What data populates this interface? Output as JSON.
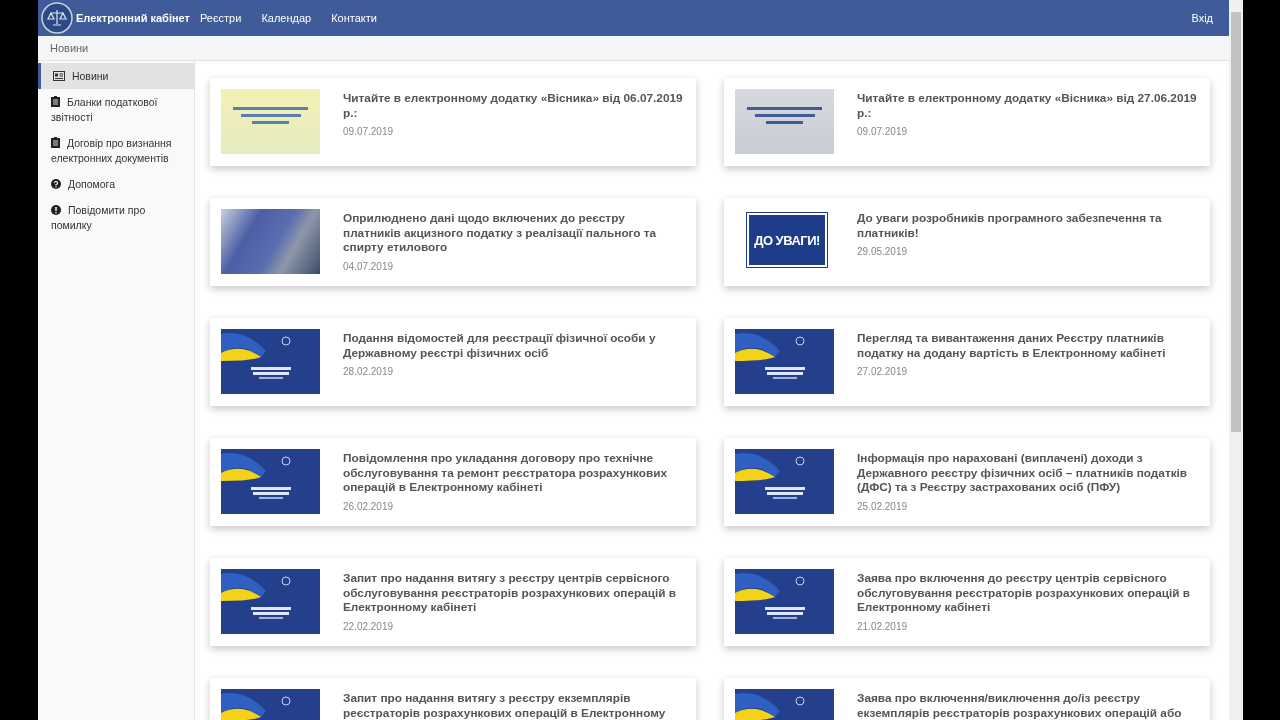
{
  "navbar": {
    "brand": "Електронний кабінет",
    "links": [
      "Реєстри",
      "Календар",
      "Контакти"
    ],
    "login": "Вхід"
  },
  "breadcrumb": "Новини",
  "sidebar": {
    "items": [
      {
        "label": "Новини",
        "selected": true
      },
      {
        "label": "Бланки податкової звітності",
        "selected": false
      },
      {
        "label": "Договір про визнання електронних документів",
        "selected": false
      },
      {
        "label": "Допомога",
        "selected": false
      },
      {
        "label": "Повідомити про помилку",
        "selected": false
      }
    ]
  },
  "news": [
    {
      "title": "Читайте в електронному додатку «Вісника» від 06.07.2019 р.:",
      "date": "09.07.2019",
      "thumb": {
        "kind": "yellow-banner"
      }
    },
    {
      "title": "Читайте в електронному додатку «Вісника» від 27.06.2019 р.:",
      "date": "09.07.2019",
      "thumb": {
        "kind": "grey-banner"
      }
    },
    {
      "title": "Оприлюднено дані щодо включених до реєстру платників акцизного податку з реалізації пального та спирту етилового",
      "date": "04.07.2019",
      "thumb": {
        "kind": "photo"
      }
    },
    {
      "title": "До уваги розробників програмного забезпечення та платників!",
      "date": "29.05.2019",
      "thumb": {
        "kind": "notice",
        "text": "ДО УВАГИ!"
      }
    },
    {
      "title": "Подання відомостей для реєстрації фізичної особи у Державному реєстрі фізичних осіб",
      "date": "28.02.2019",
      "thumb": {
        "kind": "flag-banner"
      }
    },
    {
      "title": "Перегляд та вивантаження даних Реєстру платників податку на додану вартість в Електронному кабінеті",
      "date": "27.02.2019",
      "thumb": {
        "kind": "flag-banner"
      }
    },
    {
      "title": "Повідомлення про укладання договору про технічне обслуговування та ремонт реєстратора розрахункових операцій в Електронному кабінеті",
      "date": "26.02.2019",
      "thumb": {
        "kind": "flag-banner"
      }
    },
    {
      "title": "Інформація про нараховані (виплачені) доходи з Державного реєстру фізичних осіб – платників податків (ДФС) та з Реєстру застрахованих осіб (ПФУ)",
      "date": "25.02.2019",
      "thumb": {
        "kind": "flag-banner"
      }
    },
    {
      "title": "Запит про надання витягу з реєстру центрів сервісного обслуговування реєстраторів розрахункових операцій в Електронному кабінеті",
      "date": "22.02.2019",
      "thumb": {
        "kind": "flag-banner"
      }
    },
    {
      "title": "Заява про включення до реєстру центрів сервісного обслуговування реєстраторів розрахункових операцій в Електронному кабінеті",
      "date": "21.02.2019",
      "thumb": {
        "kind": "flag-banner"
      }
    },
    {
      "title": "Запит про надання витягу з реєстру екземплярів реєстраторів розрахункових операцій в Електронному",
      "thumb": {
        "kind": "flag-banner"
      }
    },
    {
      "title": "Заява про включення/виключення до/із реєстру екземплярів реєстраторів розрахункових операцій або",
      "thumb": {
        "kind": "flag-banner"
      }
    }
  ]
}
